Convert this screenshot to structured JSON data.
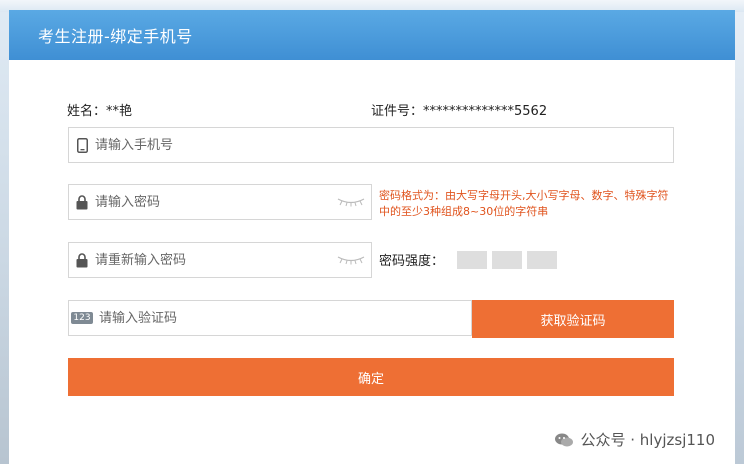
{
  "header": {
    "title": "考生注册-绑定手机号"
  },
  "info": {
    "name_label": "姓名：",
    "name_value": "**艳",
    "id_label": "证件号：",
    "id_value": "**************5562"
  },
  "form": {
    "phone_placeholder": "请输入手机号",
    "password_placeholder": "请输入密码",
    "password_confirm_placeholder": "请重新输入密码",
    "code_placeholder": "请输入验证码",
    "code_badge": "123",
    "password_tip": "密码格式为：由大写字母开头,大小写字母、数字、特殊字符中的至少3种组成8~30位的字符串",
    "strength_label": "密码强度：",
    "get_code_button": "获取验证码",
    "confirm_button": "确定"
  },
  "watermark": {
    "text": "公众号 · hlyjzsj110"
  },
  "colors": {
    "header": "#4a9ad9",
    "accent": "#ee6f34",
    "tip": "#e0541e"
  },
  "icons": [
    "phone-icon",
    "lock-icon",
    "eye-closed-icon",
    "code-123-icon",
    "wechat-icon"
  ]
}
